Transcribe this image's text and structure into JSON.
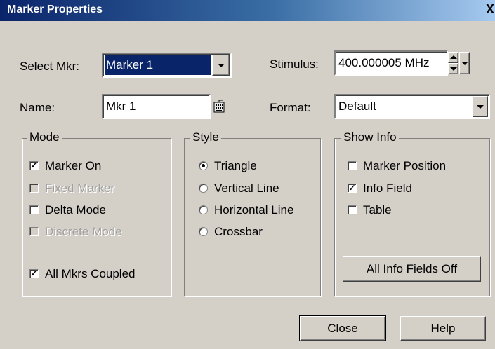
{
  "window": {
    "title": "Marker Properties",
    "close_glyph": "X"
  },
  "select_mkr": {
    "label": "Select Mkr:",
    "value": "Marker 1"
  },
  "stimulus": {
    "label": "Stimulus:",
    "value": "400.000005 MHz"
  },
  "name": {
    "label": "Name:",
    "value": "Mkr 1"
  },
  "format": {
    "label": "Format:",
    "value": "Default"
  },
  "mode": {
    "title": "Mode",
    "items": [
      {
        "label": "Marker On",
        "checked": true,
        "enabled": true
      },
      {
        "label": "Fixed Marker",
        "checked": false,
        "enabled": false
      },
      {
        "label": "Delta Mode",
        "checked": false,
        "enabled": true
      },
      {
        "label": "Discrete Mode",
        "checked": false,
        "enabled": false
      },
      {
        "label": "All Mkrs Coupled",
        "checked": true,
        "enabled": true
      }
    ]
  },
  "style": {
    "title": "Style",
    "items": [
      {
        "label": "Triangle",
        "selected": true
      },
      {
        "label": "Vertical Line",
        "selected": false
      },
      {
        "label": "Horizontal Line",
        "selected": false
      },
      {
        "label": "Crossbar",
        "selected": false
      }
    ]
  },
  "show_info": {
    "title": "Show Info",
    "items": [
      {
        "label": "Marker Position",
        "checked": false
      },
      {
        "label": "Info Field",
        "checked": true
      },
      {
        "label": "Table",
        "checked": false
      }
    ],
    "all_off_button": "All Info Fields Off"
  },
  "buttons": {
    "close": "Close",
    "help": "Help"
  }
}
